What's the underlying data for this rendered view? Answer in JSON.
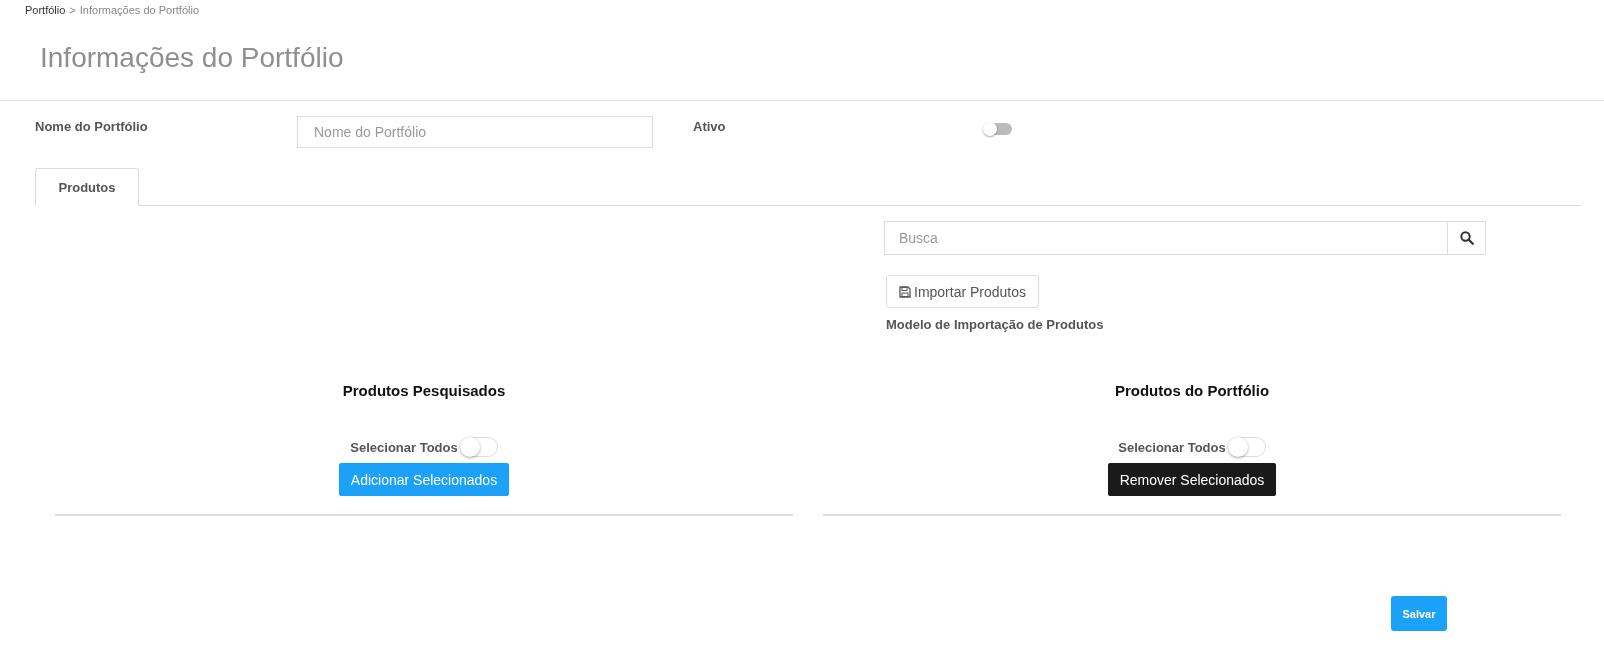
{
  "breadcrumb": [
    {
      "label": "Portfólio",
      "current": false
    },
    {
      "label": "Informações do Portfólio",
      "current": true
    }
  ],
  "breadcrumb_separator": ">",
  "title": "Informações do Portfólio",
  "form": {
    "name_label": "Nome do Portfólio",
    "name_placeholder": "Nome do Portfólio",
    "active_label": "Ativo",
    "active_on": false
  },
  "tabs": [
    {
      "label": "Produtos",
      "selected": true
    }
  ],
  "search": {
    "placeholder": "Busca"
  },
  "import_button": "Importar Produtos",
  "import_template_link": "Modelo de Importação de Produtos",
  "panels": [
    {
      "kind": "add",
      "title": "Produtos Pesquisados",
      "select_all_label": "Selecionar Todos",
      "select_all_on": false,
      "button": "Adicionar Selecionados"
    },
    {
      "kind": "remove",
      "title": "Produtos do Portfólio",
      "select_all_label": "Selecionar Todos",
      "select_all_on": false,
      "button": "Remover Selecionados"
    }
  ],
  "save_button": "Salvar"
}
